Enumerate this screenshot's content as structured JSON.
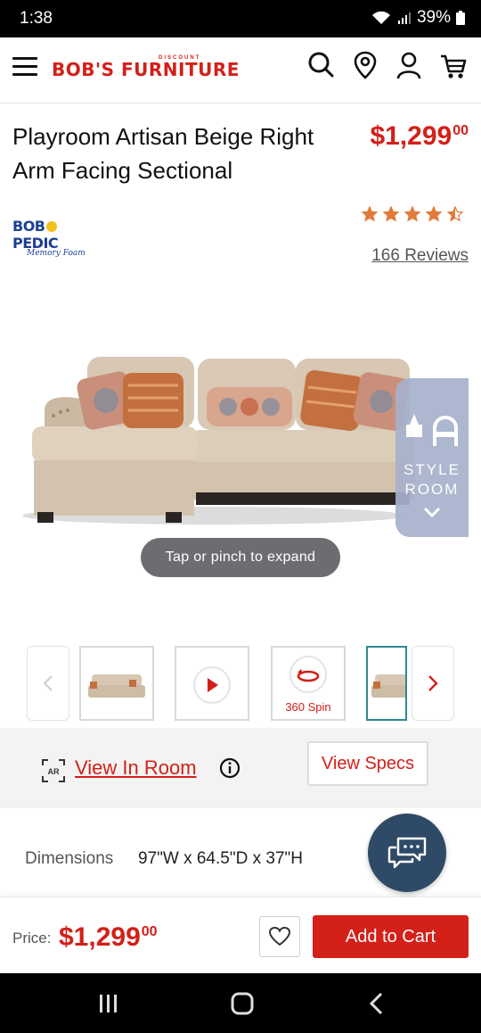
{
  "status_bar": {
    "time": "1:38",
    "battery": "39%"
  },
  "header": {
    "logo_main": "BOB'S FURNITURE",
    "logo_sub": "DISCOUNT"
  },
  "product": {
    "title": "Playroom Artisan Beige Right Arm Facing Sectional",
    "price_dollars": "$1,299",
    "price_cents": "00",
    "brand_name_left": "BOB",
    "brand_name_right": "PEDIC",
    "brand_sub": "Memory Foam",
    "rating": 4.5,
    "rating_max": 5,
    "reviews_label": "166 Reviews"
  },
  "image_panel": {
    "style_room_line1": "STYLE",
    "style_room_line2": "ROOM",
    "expand_hint": "Tap or pinch to expand"
  },
  "thumbnails": [
    {
      "kind": "photo",
      "caption": ""
    },
    {
      "kind": "video",
      "caption": ""
    },
    {
      "kind": "spin",
      "caption": "360 Spin"
    },
    {
      "kind": "photo",
      "caption": ""
    }
  ],
  "view_bar": {
    "ar_badge": "AR",
    "view_in_room": "View In Room",
    "view_specs": "View Specs"
  },
  "details": {
    "dimensions_label": "Dimensions",
    "dimensions_value": "97\"W x 64.5\"D x 37\"H"
  },
  "footer": {
    "price_label": "Price:",
    "price_dollars": "$1,299",
    "price_cents": "00",
    "add_to_cart": "Add to Cart"
  },
  "colors": {
    "brand_red": "#d32018",
    "brand_blue": "#1c3f94",
    "star_orange": "#e07b39",
    "active_thumb": "#2a8a93",
    "chat_fab": "#2f4a66"
  }
}
